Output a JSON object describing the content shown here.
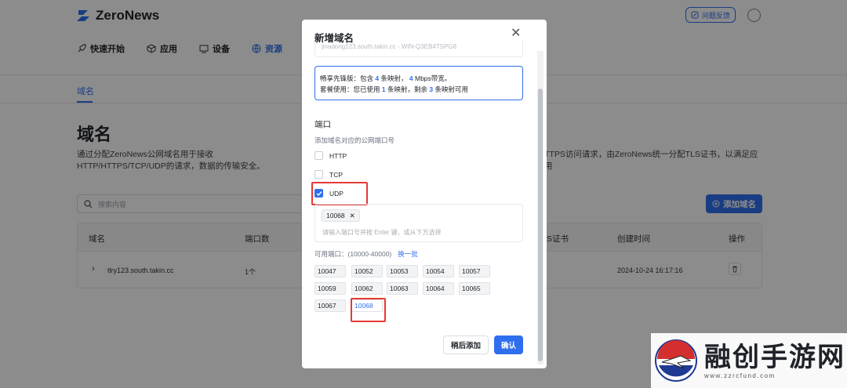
{
  "app": {
    "brand": "ZeroNews",
    "feedback_label": "问题反馈",
    "nav": [
      {
        "label": "快速开始",
        "icon": "rocket-icon"
      },
      {
        "label": "应用",
        "icon": "cube-icon"
      },
      {
        "label": "设备",
        "icon": "monitor-icon"
      },
      {
        "label": "资源",
        "icon": "globe-icon",
        "active": true
      }
    ],
    "subtab": "域名",
    "page_title": "域名",
    "description": "通过分配ZeroNews公网域名用于接收 HTTP/HTTPS/TCP/UDP的请求，数据的传输安全。",
    "description_right": "TTPS访问请求，由ZeroNews统一分配TLS证书，以满足应用",
    "search_placeholder": "搜索内容",
    "add_button": "添加域名",
    "table": {
      "headers": [
        "域名",
        "端口数",
        "S证书",
        "创建时间",
        "操作"
      ],
      "rows": [
        {
          "domain": "tlry123.south.takin.cc",
          "ports": "1个",
          "created": "2024-10-24 16:17:16"
        }
      ]
    }
  },
  "modal": {
    "title": "新增域名",
    "cut_field_text": "jinadong123.south.takin.cc - WIN-Q3EB4TSPG8",
    "plan_line1": {
      "a": "畅享先锋版：包含",
      "n1": "4",
      "b": "条映射，",
      "n2": "4",
      "c": "Mbps带宽。"
    },
    "plan_line2": {
      "a": "套餐使用：您已使用",
      "n1": "1",
      "b": "条映射，剩余",
      "n2": "3",
      "c": "条映射可用"
    },
    "port_title": "端口",
    "port_hint": "添加域名对应的公网端口号",
    "protocols": [
      {
        "label": "HTTP",
        "checked": false
      },
      {
        "label": "TCP",
        "checked": false
      },
      {
        "label": "UDP",
        "checked": true
      }
    ],
    "selected_port": "10068",
    "port_placeholder": "请输入端口号并按 Enter 键，或从下方选择",
    "available_label": "可用端口：(10000-40000)",
    "swap_label": "换一批",
    "ports": [
      "10047",
      "10052",
      "10053",
      "10054",
      "10057",
      "10059",
      "10062",
      "10063",
      "10064",
      "10065",
      "10067",
      "10068"
    ],
    "btn_later": "稍后添加",
    "btn_ok": "确认"
  },
  "watermark": {
    "text": "融创手游网",
    "url": "www.zzrcfund.com"
  },
  "colors": {
    "accent": "#2f6fed",
    "highlight": "#e53935"
  }
}
